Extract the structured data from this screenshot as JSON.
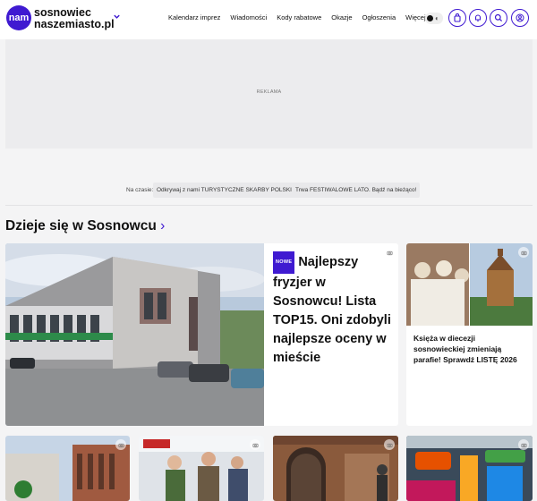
{
  "header": {
    "logo_mark": "nam",
    "logo_line1": "sosnowiec",
    "logo_line2": "naszemiasto.pl",
    "nav": [
      "Kalendarz imprez",
      "Wiadomości",
      "Kody rabatowe",
      "Okazje",
      "Ogłoszenia",
      "Więcej"
    ]
  },
  "ad": {
    "label": "REKLAMA"
  },
  "now_bar": {
    "label": "Na czasie:",
    "pills": [
      "Odkrywaj z nami TURYSTYCZNE SKARBY POLSKI",
      "Trwa FESTIWALOWE LATO. Bądź na bieżąco!"
    ]
  },
  "section": {
    "title": "Dzieje się w Sosnowcu",
    "chevron": "›"
  },
  "main_article": {
    "badge": "NOWE",
    "title": "Najlepszy fryzjer w Sosnowcu! Lista TOP15. Oni zdobyli najlepsze oceny w mieście"
  },
  "side_article": {
    "title": "Księża w diecezji sosnowieckiej zmieniają parafie! Sprawdź LISTĘ 2026"
  },
  "colors": {
    "brand": "#3f1ad1"
  },
  "icons": [
    "chevron-down-icon",
    "theme-toggle-icon",
    "bag-icon",
    "bell-icon",
    "search-icon",
    "user-icon",
    "camera-icon"
  ]
}
